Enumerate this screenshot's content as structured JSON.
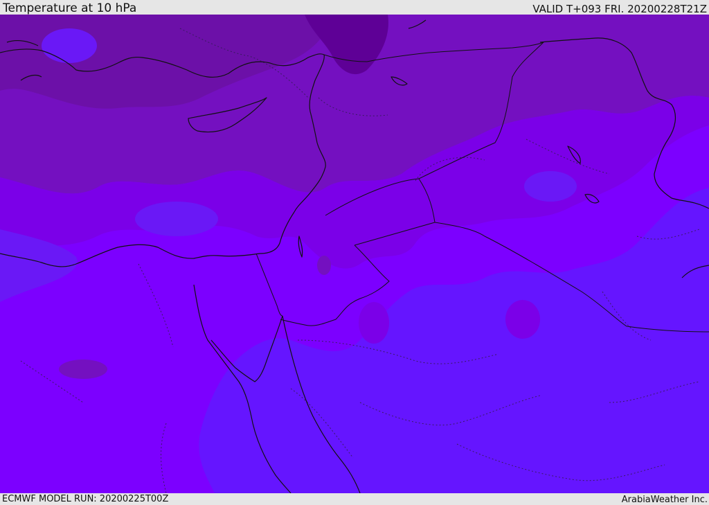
{
  "header": {
    "title": "Temperature at 10 hPa",
    "valid_time": "VALID T+093 FRI. 20200228T21Z"
  },
  "footer": {
    "model_run": "ECMWF MODEL RUN: 20200225T00Z",
    "credit": "ArabiaWeather Inc."
  },
  "map": {
    "field": "temperature",
    "level": "10 hPa",
    "colors": {
      "very_cold": "#5e0096",
      "colder": "#6c10a8",
      "cold": "#7410c0",
      "mid": "#7b00e8",
      "base": "#7c00ff",
      "warmer": "#6a18f6",
      "warm": "#6515ff",
      "coast": "#111111",
      "border": "#111111",
      "contour": "#3a1a60"
    }
  }
}
